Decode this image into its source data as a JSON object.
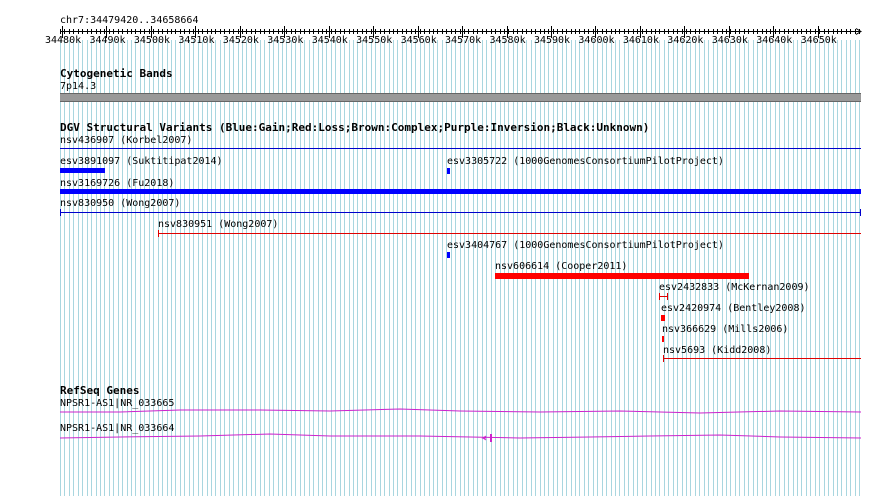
{
  "colors": {
    "grid": "#a9d6df",
    "gain": "#0000ff",
    "loss": "#ff0000",
    "track_line_blue": "#0000cc",
    "track_line_red": "#e00000",
    "refseq": "#cc22cc",
    "band": "#999999"
  },
  "ruler": {
    "location": "chr7:34479420..34658664",
    "ticks": [
      "34480k",
      "34490k",
      "34500k",
      "34510k",
      "34520k",
      "34530k",
      "34540k",
      "34550k",
      "34560k",
      "34570k",
      "34580k",
      "34590k",
      "34600k",
      "34610k",
      "34620k",
      "34630k",
      "34640k",
      "34650k"
    ]
  },
  "cytoband": {
    "title": "Cytogenetic Bands",
    "band": "7p14.3"
  },
  "dgv": {
    "title": "DGV Structural Variants (Blue:Gain;Red:Loss;Brown:Complex;Purple:Inversion;Black:Unknown)",
    "features": [
      {
        "label": "nsv436907 (Korbel2007)",
        "type": "gain",
        "style": "line"
      },
      {
        "label": "esv3891097 (Suktitipat2014)",
        "type": "gain",
        "style": "bar"
      },
      {
        "label": "esv3305722 (1000GenomesConsortiumPilotProject)",
        "type": "gain",
        "style": "bar"
      },
      {
        "label": "nsv3169726 (Fu2018)",
        "type": "gain",
        "style": "bar"
      },
      {
        "label": "nsv830950 (Wong2007)",
        "type": "gain",
        "style": "line"
      },
      {
        "label": "nsv830951 (Wong2007)",
        "type": "loss",
        "style": "line"
      },
      {
        "label": "esv3404767 (1000GenomesConsortiumPilotProject)",
        "type": "gain",
        "style": "bar"
      },
      {
        "label": "nsv606614 (Cooper2011)",
        "type": "loss",
        "style": "bar"
      },
      {
        "label": "esv2432833 (McKernan2009)",
        "type": "loss",
        "style": "line"
      },
      {
        "label": "esv2420974 (Bentley2008)",
        "type": "loss",
        "style": "bar"
      },
      {
        "label": "nsv366629 (Mills2006)",
        "type": "loss",
        "style": "bar"
      },
      {
        "label": "nsv5693 (Kidd2008)",
        "type": "loss",
        "style": "line"
      }
    ]
  },
  "refseq": {
    "title": "RefSeq Genes",
    "genes": [
      {
        "label": "NPSR1-AS1|NR_033665"
      },
      {
        "label": "NPSR1-AS1|NR_033664"
      }
    ]
  }
}
